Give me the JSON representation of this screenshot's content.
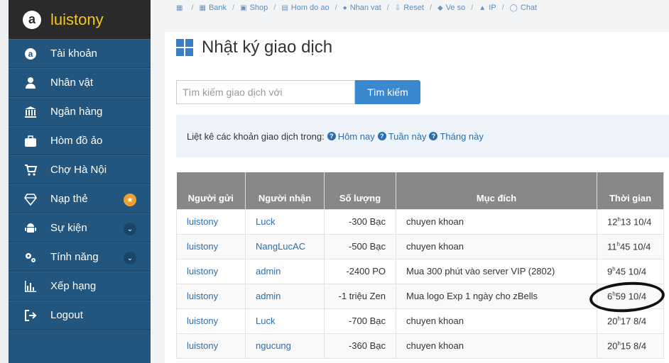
{
  "brand": {
    "name": "luistony",
    "logo_letter": "a"
  },
  "sidebar": {
    "items": [
      {
        "label": "Tài khoản",
        "icon": "amazon-icon"
      },
      {
        "label": "Nhân vật",
        "icon": "user-icon"
      },
      {
        "label": "Ngân hàng",
        "icon": "bank-icon"
      },
      {
        "label": "Hòm đồ ảo",
        "icon": "suitcase-icon"
      },
      {
        "label": "Chợ Hà Nội",
        "icon": "cart-icon"
      },
      {
        "label": "Nạp thẻ",
        "icon": "diamond-icon",
        "badge": "★"
      },
      {
        "label": "Sự kiện",
        "icon": "android-icon",
        "badge": "⌄"
      },
      {
        "label": "Tính năng",
        "icon": "gears-icon",
        "badge": "⌄"
      },
      {
        "label": "Xếp hạng",
        "icon": "bar-chart-icon"
      },
      {
        "label": "Logout",
        "icon": "logout-icon"
      }
    ]
  },
  "breadcrumb": {
    "items": [
      {
        "label": "",
        "icon": "▦"
      },
      {
        "label": "Bank",
        "icon": "▦"
      },
      {
        "label": "Shop",
        "icon": "▣"
      },
      {
        "label": "Hom do ao",
        "icon": "▤"
      },
      {
        "label": "Nhan vat",
        "icon": "●"
      },
      {
        "label": "Reset",
        "icon": "⇩"
      },
      {
        "label": "Ve so",
        "icon": "◆"
      },
      {
        "label": "IP",
        "icon": "▲"
      },
      {
        "label": "Chat",
        "icon": "◯"
      }
    ]
  },
  "page": {
    "title": "Nhật ký giao dịch"
  },
  "search": {
    "placeholder": "Tìm kiếm giao dịch với",
    "button_label": "Tìm kiếm"
  },
  "filter": {
    "text": "Liệt kê các khoản giao dịch trong:",
    "links": [
      "Hôm nay",
      "Tuần này",
      "Tháng này"
    ]
  },
  "table": {
    "headers": [
      "Người gửi",
      "Người nhận",
      "Số lượng",
      "Mục đích",
      "Thời gian"
    ],
    "rows": [
      {
        "sender": "luistony",
        "receiver": "Luck",
        "amount": "-300  Bạc",
        "purpose": "chuyen khoan",
        "hour": "12",
        "rest": "13 10/4"
      },
      {
        "sender": "luistony",
        "receiver": "NangLucAC",
        "amount": "-500  Bạc",
        "purpose": "chuyen khoan",
        "hour": "11",
        "rest": "45 10/4"
      },
      {
        "sender": "luistony",
        "receiver": "admin",
        "amount": "-2400  PO",
        "purpose": "Mua 300 phút vào server VIP (2802)",
        "hour": "9",
        "rest": "45 10/4"
      },
      {
        "sender": "luistony",
        "receiver": "admin",
        "amount": "-1  triệu Zen",
        "purpose": "Mua logo Exp 1 ngày cho zBells",
        "hour": "6",
        "rest": "59 10/4"
      },
      {
        "sender": "luistony",
        "receiver": "Luck",
        "amount": "-700  Bạc",
        "purpose": "chuyen khoan",
        "hour": "20",
        "rest": "17 8/4"
      },
      {
        "sender": "luistony",
        "receiver": "ngucung",
        "amount": "-360  Bạc",
        "purpose": "chuyen khoan",
        "hour": "20",
        "rest": "15 8/4"
      }
    ],
    "hour_suffix": "h"
  },
  "colors": {
    "sidebar": "#23567f",
    "brand_bg": "#2a2a2a",
    "brand_text": "#f5c518",
    "link": "#2a6fb0",
    "button": "#3a89cf"
  }
}
